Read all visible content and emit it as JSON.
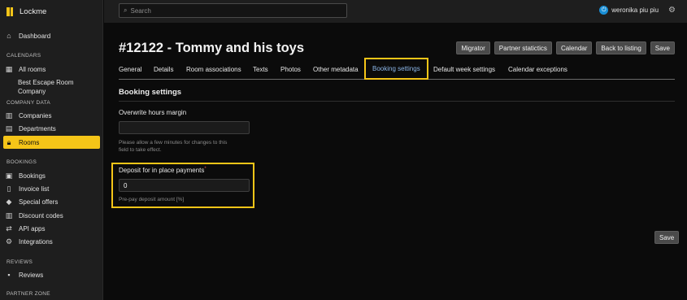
{
  "brand": {
    "name": "Lockme"
  },
  "search": {
    "placeholder": "Search"
  },
  "user": {
    "name": "weronika piu piu"
  },
  "sidebar": {
    "dashboard": "Dashboard",
    "sections": {
      "calendars": "CALENDARS",
      "company_data": "COMPANY DATA",
      "bookings": "BOOKINGS",
      "reviews": "REVIEWS",
      "partner_zone": "PARTNER ZONE"
    },
    "calendars": {
      "all_rooms": "All rooms",
      "sub_line1": "Best Escape Room",
      "sub_line2": "Company"
    },
    "company_data": {
      "companies": "Companies",
      "departments": "Departments",
      "rooms": "Rooms"
    },
    "bookings": {
      "bookings": "Bookings",
      "invoice_list": "Invoice list",
      "special_offers": "Special offers",
      "discount_codes": "Discount codes",
      "api_apps": "API apps",
      "integrations": "Integrations"
    },
    "reviews": {
      "reviews": "Reviews"
    }
  },
  "page": {
    "title": "#12122 - Tommy and his toys",
    "buttons": {
      "migrator": "Migrator",
      "partner_statistics": "Partner statictics",
      "calendar": "Calendar",
      "back": "Back to listing",
      "save": "Save"
    },
    "tabs": [
      "General",
      "Details",
      "Room associations",
      "Texts",
      "Photos",
      "Other metadata",
      "Booking settings",
      "Default week settings",
      "Calendar exceptions"
    ],
    "active_tab": "Booking settings",
    "section_title": "Booking settings",
    "fields": {
      "overwrite": {
        "label": "Overwrite hours margin",
        "value": "",
        "help_line1": "Please allow a few minutes for changes to this",
        "help_line2": "field to take effect."
      },
      "deposit": {
        "label": "Deposit for in place payments",
        "required_mark": "*",
        "value": "0",
        "help": "Pre-pay deposit amount [%]"
      }
    },
    "save_bottom": "Save"
  },
  "colors": {
    "accent": "#f5c518",
    "active_tab_text": "#8cb6e8",
    "background": "#0b0b0b",
    "sidebar": "#1e1e1e"
  }
}
